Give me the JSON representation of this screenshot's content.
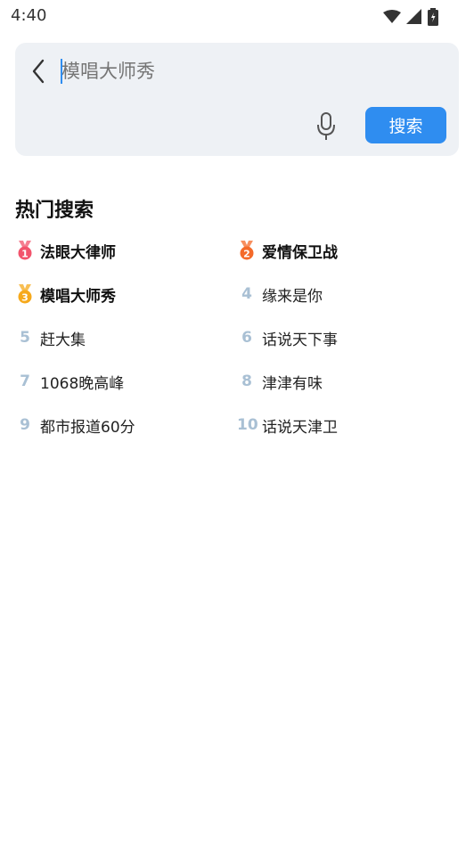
{
  "status_bar": {
    "time": "4:40",
    "icons": [
      "wifi-icon",
      "signal-icon",
      "battery-icon"
    ]
  },
  "search": {
    "placeholder": "模唱大师秀",
    "button_label": "搜索",
    "icons": [
      "back-chevron-icon",
      "microphone-icon"
    ]
  },
  "hot_search": {
    "title": "热门搜索",
    "items": [
      {
        "rank": "1",
        "label": "法眼大律师",
        "badge_color": "#f2546c"
      },
      {
        "rank": "2",
        "label": "爱情保卫战",
        "badge_color": "#f46a2a"
      },
      {
        "rank": "3",
        "label": "模唱大师秀",
        "badge_color": "#f6a91b"
      },
      {
        "rank": "4",
        "label": "缘来是你"
      },
      {
        "rank": "5",
        "label": "赶大集"
      },
      {
        "rank": "6",
        "label": "话说天下事"
      },
      {
        "rank": "7",
        "label": "1068晚高峰"
      },
      {
        "rank": "8",
        "label": "津津有味"
      },
      {
        "rank": "9",
        "label": "都市报道60分"
      },
      {
        "rank": "10",
        "label": "话说天津卫"
      }
    ]
  },
  "colors": {
    "accent": "#2f8df0",
    "search_bg": "#eef1f5",
    "rank_text": "#a9c0d4"
  }
}
